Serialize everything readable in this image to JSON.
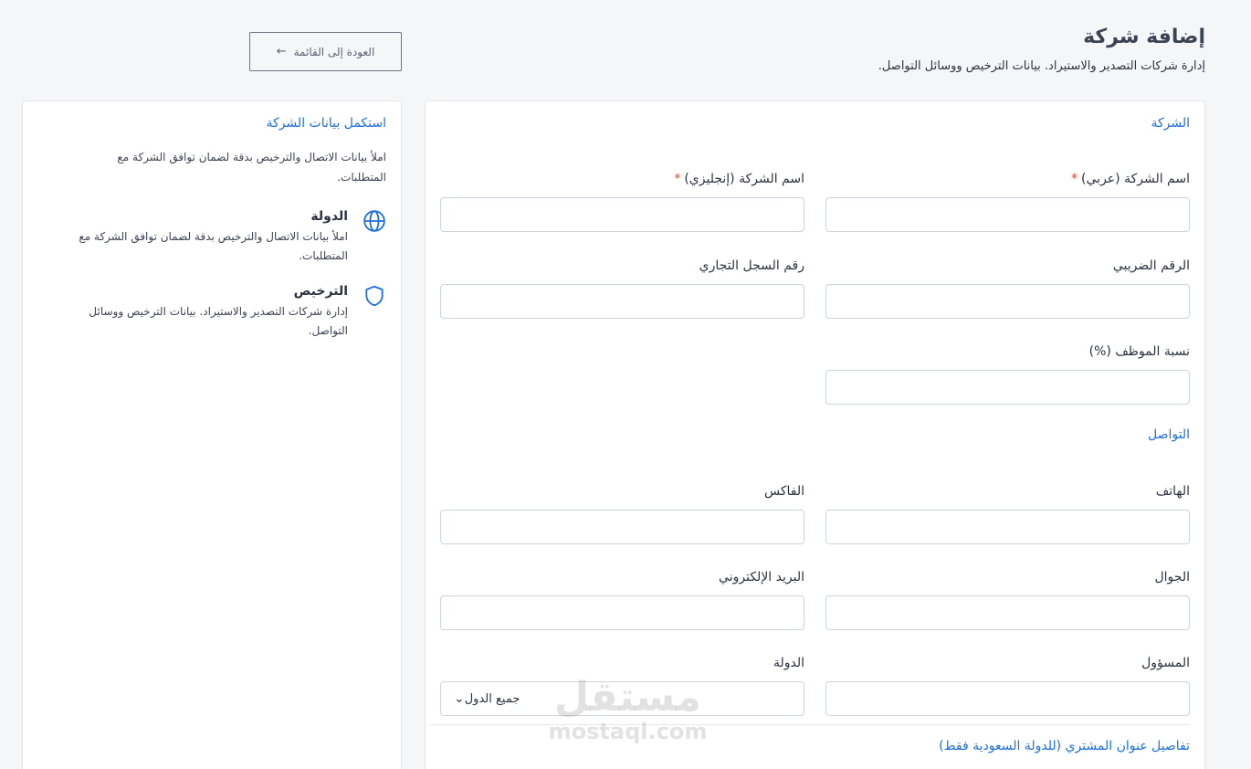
{
  "header": {
    "title": "إضافة شركة",
    "subtitle": "إدارة شركات التصدير والاستيراد. بيانات الترخيص ووسائل التواصل.",
    "back_button": "العودة إلى القائمة"
  },
  "form": {
    "company_section": "الشركة",
    "fields": {
      "name_ar": "اسم الشركة (عربي)",
      "name_en": "اسم الشركة (إنجليزي)",
      "tax_number": "الرقم الضريبي",
      "commercial_register": "رقم السجل التجاري",
      "employee_ratio": "نسبة الموظف (%)",
      "phone": "الهاتف",
      "fax": "الفاكس",
      "mobile": "الجوال",
      "email": "البريد الإلكتروني",
      "responsible": "المسؤول",
      "country": "الدولة"
    },
    "required_mark": "*",
    "contact_section": "التواصل",
    "country_select_value": "جميع الدول",
    "address_section": "تفاصيل عنوان المشتري (للدولة السعودية فقط)"
  },
  "sidebar": {
    "title": "استكمل بيانات الشركة",
    "description": "املأ بيانات الاتصال والترخيص بدقة لضمان توافق الشركة مع المتطلبات.",
    "items": [
      {
        "title": "الدولة",
        "description": "املأ بيانات الاتصال والترخيص بدقة لضمان توافق الشركة مع المتطلبات.",
        "icon": "globe-icon"
      },
      {
        "title": "الترخيص",
        "description": "إدارة شركات التصدير والاستيراد. بيانات الترخيص ووسائل التواصل.",
        "icon": "shield-icon"
      }
    ]
  },
  "watermark": {
    "arabic": "مستقل",
    "latin": "mostaql.com"
  },
  "colors": {
    "accent": "#1f6fe0",
    "required": "#e0442d",
    "background": "#f5f6f8"
  }
}
